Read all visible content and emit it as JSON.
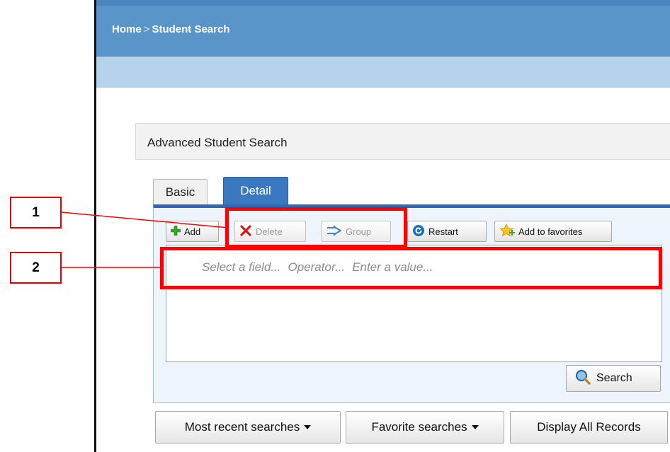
{
  "breadcrumb": {
    "home": "Home",
    "separator": ">",
    "current": "Student Search"
  },
  "section": {
    "title": "Advanced Student Search"
  },
  "tabs": [
    {
      "label": "Basic",
      "active": false
    },
    {
      "label": "Detail",
      "active": true
    }
  ],
  "toolbar": {
    "add": "Add",
    "delete": "Delete",
    "group": "Group",
    "restart": "Restart",
    "favorites": "Add to favorites"
  },
  "query": {
    "field": "Select a field...",
    "operator": "Operator...",
    "value": "Enter a value..."
  },
  "search_button": "Search",
  "bottom_buttons": {
    "recent": "Most recent searches",
    "favorite": "Favorite searches",
    "display_all": "Display All Records"
  },
  "callouts": [
    "1",
    "2"
  ],
  "colors": {
    "topbar": "#5a95c9",
    "subbar": "#b7d3ec",
    "active_tab": "#3a78c2",
    "highlight": "#ff0000"
  }
}
